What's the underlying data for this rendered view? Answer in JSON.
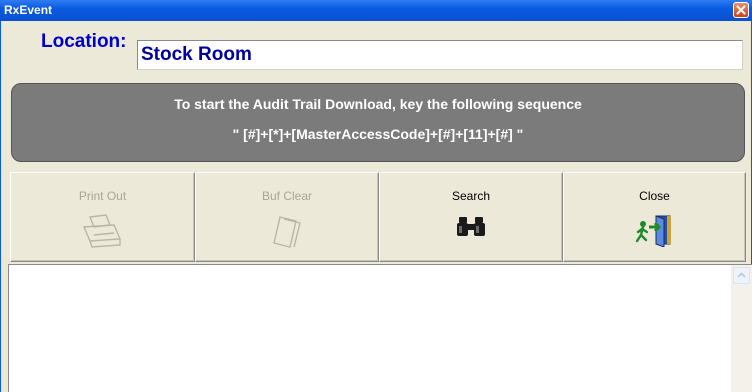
{
  "window": {
    "title": "RxEvent",
    "close_icon": "close-x-icon"
  },
  "location": {
    "label": "Location:",
    "value": "Stock Room"
  },
  "banner": {
    "line1": "To start the Audit Trail Download, key the following sequence",
    "line2": "\" [#]+[*]+[MasterAccessCode]+[#]+[11]+[#] \""
  },
  "toolbar": {
    "buttons": [
      {
        "label": "Print Out",
        "icon": "printer-icon",
        "enabled": false
      },
      {
        "label": "Buf Clear",
        "icon": "eraser-icon",
        "enabled": false
      },
      {
        "label": "Search",
        "icon": "binoculars-icon",
        "enabled": true
      },
      {
        "label": "Close",
        "icon": "exit-door-icon",
        "enabled": true
      }
    ]
  },
  "colors": {
    "title_bar": "#0a5be0",
    "location_label": "#0000cc",
    "banner_bg": "#7b7b7b",
    "disabled_text": "#a9a699"
  }
}
